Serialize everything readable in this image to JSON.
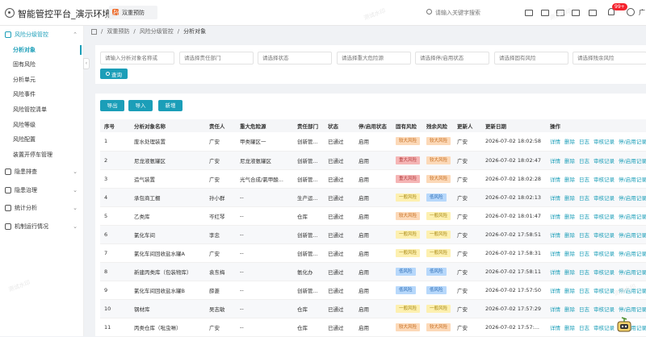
{
  "app": {
    "title": "智能管控平台_演示环境"
  },
  "system_tab": {
    "label": "双重预防"
  },
  "search": {
    "placeholder": "请输入关键字搜索"
  },
  "notifications": {
    "badge": "99+"
  },
  "user": {
    "name": "广"
  },
  "sidebar": {
    "groups": [
      {
        "label": "风险分级管控",
        "expanded": true
      },
      {
        "label": "隐患排查",
        "expanded": false
      },
      {
        "label": "隐患治理",
        "expanded": false
      },
      {
        "label": "统计分析",
        "expanded": false
      },
      {
        "label": "机制运行情况",
        "expanded": false
      }
    ],
    "subitems": [
      "分析对象",
      "固有风险",
      "分析单元",
      "风险事件",
      "风险管控清单",
      "风险等级",
      "风险配置",
      "装置开停车管理"
    ],
    "active_subitem": "分析对象"
  },
  "breadcrumb": [
    "双重预防",
    "风险分级管控",
    "分析对象"
  ],
  "filters": {
    "placeholders": [
      "请输入分析对象名称或",
      "请选择责任部门",
      "请选择状态",
      "请选择重大危险源",
      "请选择停/启用状态",
      "请选择固有风险",
      "请选择残余风险"
    ],
    "query_label": "查询"
  },
  "actions": {
    "export": "导出",
    "import": "导入",
    "add": "新增"
  },
  "table": {
    "headers": [
      "序号",
      "分析对象名称",
      "责任人",
      "重大危险源",
      "责任部门",
      "状态",
      "停/启用状态",
      "固有风险",
      "残余风险",
      "更新人",
      "更新日期",
      "操作"
    ],
    "row_actions": [
      "详情",
      "删除",
      "日志",
      "审核记录",
      "停/启用记录"
    ],
    "rows": [
      {
        "no": "1",
        "name": "废水处理装置",
        "owner": "广安",
        "hazard": "甲类罐区一",
        "dept": "创新管...",
        "status": "已通过",
        "enable": "启用",
        "inherent": "较大风险",
        "residual": "较大风险",
        "updater": "广安",
        "date": "2026-07-02 18:02:58"
      },
      {
        "no": "2",
        "name": "尼龙液氨罐区",
        "owner": "广安",
        "hazard": "尼龙液氨罐区",
        "dept": "创新管...",
        "status": "已通过",
        "enable": "启用",
        "inherent": "重大风险",
        "residual": "较大风险",
        "updater": "广安",
        "date": "2026-07-02 18:02:47"
      },
      {
        "no": "3",
        "name": "造气装置",
        "owner": "广安",
        "hazard": "光气合成/氯甲酸...",
        "dept": "创新管...",
        "status": "已通过",
        "enable": "启用",
        "inherent": "重大风险",
        "residual": "较大风险",
        "updater": "广安",
        "date": "2026-07-02 18:02:28"
      },
      {
        "no": "4",
        "name": "承包商工棚",
        "owner": "孙小群",
        "hazard": "--",
        "dept": "生产运...",
        "status": "已通过",
        "enable": "启用",
        "inherent": "一般风险",
        "residual": "低风险",
        "updater": "广安",
        "date": "2026-07-02 18:02:13"
      },
      {
        "no": "5",
        "name": "乙类库",
        "owner": "岑红琴",
        "hazard": "--",
        "dept": "仓库",
        "status": "已通过",
        "enable": "启用",
        "inherent": "较大风险",
        "residual": "一般风险",
        "updater": "广安",
        "date": "2026-07-02 18:01:47"
      },
      {
        "no": "6",
        "name": "氯化车间",
        "owner": "李忠",
        "hazard": "--",
        "dept": "创新管...",
        "status": "已通过",
        "enable": "启用",
        "inherent": "一般风险",
        "residual": "一般风险",
        "updater": "广安",
        "date": "2026-07-02 17:58:51"
      },
      {
        "no": "7",
        "name": "氯化车间回收盐水罐A",
        "owner": "广安",
        "hazard": "--",
        "dept": "创新管...",
        "status": "已通过",
        "enable": "启用",
        "inherent": "一般风险",
        "residual": "一般风险",
        "updater": "广安",
        "date": "2026-07-02 17:58:31"
      },
      {
        "no": "8",
        "name": "新建丙类库（包装物库）",
        "owner": "袁东梅",
        "hazard": "--",
        "dept": "氨化办",
        "status": "已通过",
        "enable": "启用",
        "inherent": "低风险",
        "residual": "低风险",
        "updater": "广安",
        "date": "2026-07-02 17:58:11"
      },
      {
        "no": "9",
        "name": "氯化车间回收盐水罐B",
        "owner": "薛菱",
        "hazard": "--",
        "dept": "创新管...",
        "status": "已通过",
        "enable": "启用",
        "inherent": "低风险",
        "residual": "低风险",
        "updater": "广安",
        "date": "2026-07-02 17:57:50"
      },
      {
        "no": "10",
        "name": "钢材库",
        "owner": "吴志敏",
        "hazard": "--",
        "dept": "仓库",
        "status": "已通过",
        "enable": "启用",
        "inherent": "一般风险",
        "residual": "一般风险",
        "updater": "广安",
        "date": "2026-07-02 17:57:29"
      },
      {
        "no": "11",
        "name": "丙类仓库（吡虫啉）",
        "owner": "广安",
        "hazard": "--",
        "dept": "仓库",
        "status": "已通过",
        "enable": "启用",
        "inherent": "较大风险",
        "residual": "较大风险",
        "updater": "广安",
        "date": "2026-07-02 17:57:..."
      }
    ]
  },
  "colors": {
    "accent": "#1b9eb8",
    "major": "#f5b5b5",
    "large": "#fcd9b8",
    "general": "#fdf0b0",
    "low": "#b7d8fb"
  }
}
